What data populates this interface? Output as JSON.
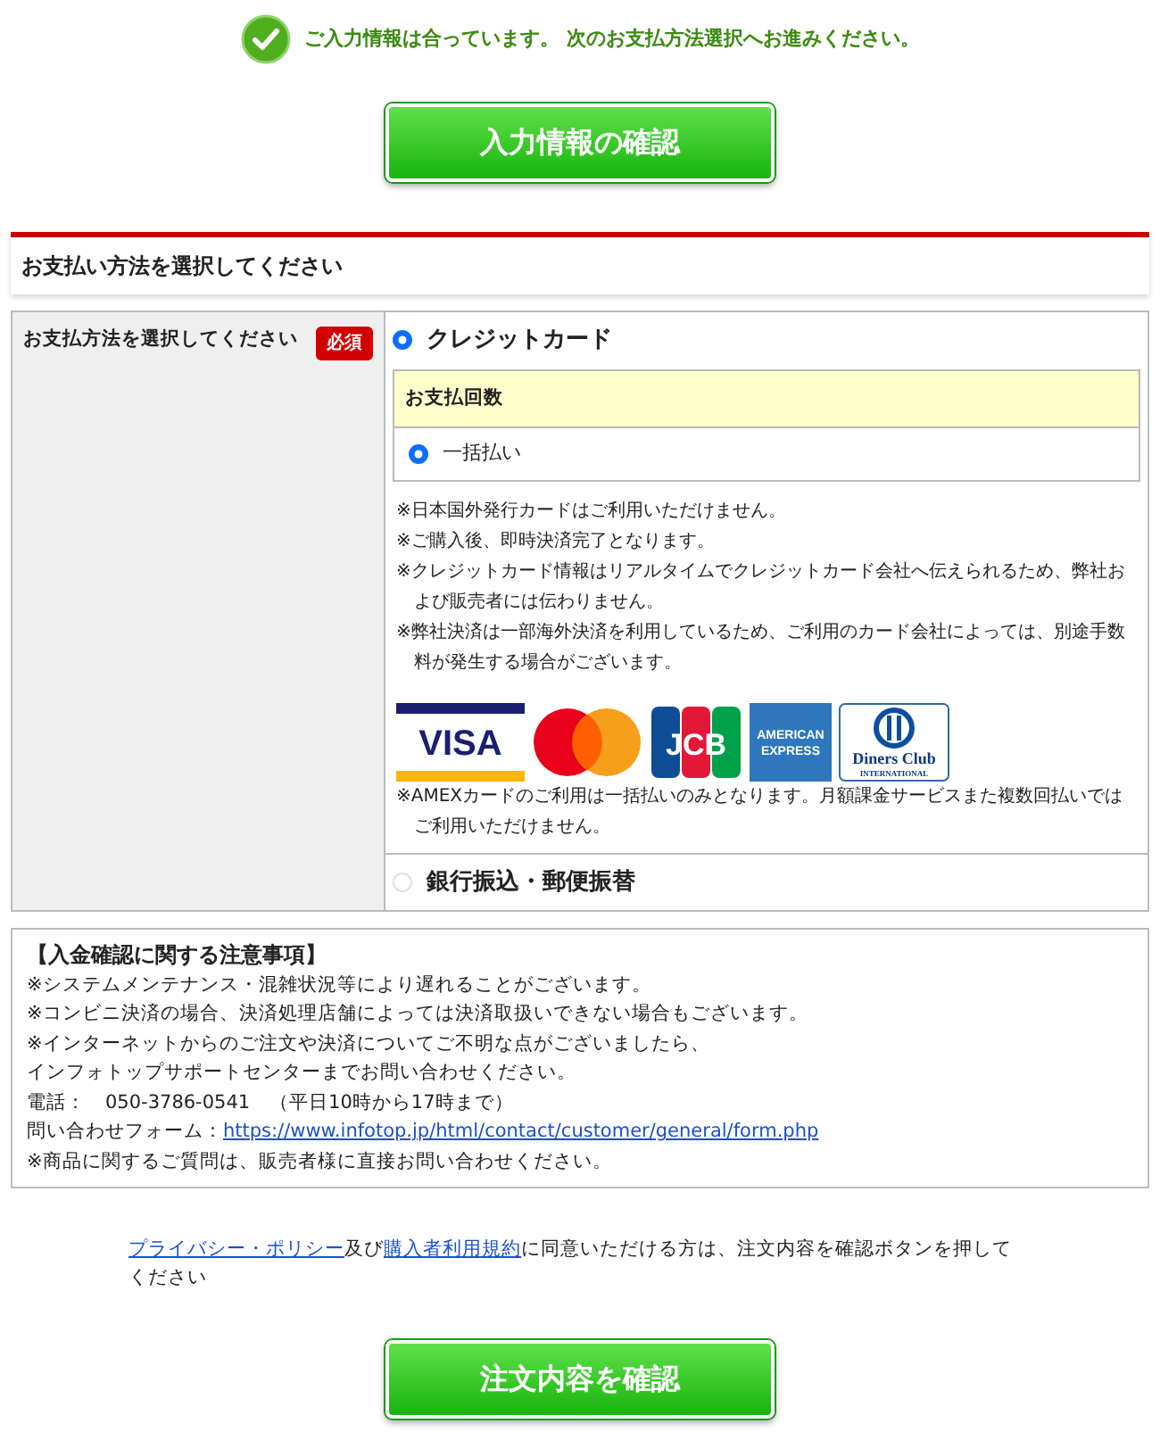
{
  "notice": {
    "text": "ご入力情報は合っています。 次のお支払方法選択へお進みください。"
  },
  "confirm_input_button": {
    "label": "入力情報の確認"
  },
  "section": {
    "title": "お支払い方法を選択してください"
  },
  "payment": {
    "label": "お支払方法を選択してください",
    "required_badge": "必須",
    "methods": [
      {
        "kind": "card",
        "label": "クレジットカード",
        "selected": true,
        "installments": {
          "title": "お支払回数",
          "options": [
            {
              "label": "一括払い",
              "selected": true
            }
          ]
        },
        "notes": [
          "※日本国外発行カードはご利用いただけません。",
          "※ご購入後、即時決済完了となります。",
          "※クレジットカード情報はリアルタイムでクレジットカード会社へ伝えられるため、弊社および販売者には伝わりません。",
          "※弊社決済は一部海外決済を利用しているため、ご利用のカード会社によっては、別途手数料が発生する場合がございます。"
        ],
        "brands": [
          {
            "kind": "visa",
            "label": "VISA"
          },
          {
            "kind": "mastercard"
          },
          {
            "kind": "jcb",
            "label": "JCB"
          },
          {
            "kind": "amex",
            "label": "AMERICAN",
            "sublabel": "EXPRESS"
          },
          {
            "kind": "diners",
            "label": "Diners Club",
            "sublabel": "INTERNATIONAL"
          }
        ],
        "footnote": "※AMEXカードのご利用は一括払いのみとなります。月額課金サービスまた複数回払いではご利用いただけません。"
      },
      {
        "kind": "bank",
        "label": "銀行振込・郵便振替",
        "selected": false
      }
    ]
  },
  "notice_box": {
    "title": "【入金確認に関する注意事項】",
    "lines": [
      {
        "text": "※システムメンテナンス・混雑状況等により遅れることがございます。"
      },
      {
        "text": "※コンビニ決済の場合、決済処理店舗によっては決済取扱いできない場合もございます。"
      },
      {
        "text": "※インターネットからのご注文や決済についてご不明な点がございましたら、"
      },
      {
        "text": "インフォトップサポートセンターまでお問い合わせください。"
      },
      {
        "text": "電話：　050-3786-0541　（平日10時から17時まで）"
      },
      {
        "text": "問い合わせフォーム：",
        "link": "https://www.infotop.jp/html/contact/customer/general/form.php"
      },
      {
        "text": "※商品に関するご質問は、販売者様に直接お問い合わせください。"
      }
    ]
  },
  "agreement": {
    "link_1": "プライバシー・ポリシー",
    "between": "及び",
    "link_2": "購入者利用規約",
    "rest": "に同意いただける方は、注文内容を確認ボタンを押してください"
  },
  "confirm_order_button": {
    "label": "注文内容を確認"
  }
}
